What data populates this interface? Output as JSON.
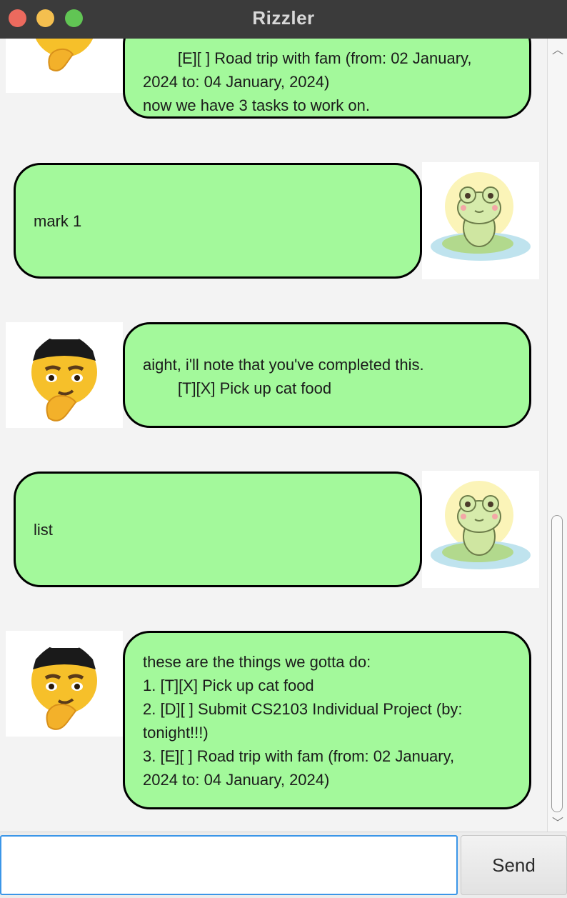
{
  "window": {
    "title": "Rizzler"
  },
  "messages": [
    {
      "sender": "bot",
      "avatar": "rizz-emoji-icon",
      "lines": [
        "        [E][ ] Road trip with fam (from: 02 January,",
        "2024 to: 04 January, 2024)",
        "now we have 3 tasks to work on."
      ]
    },
    {
      "sender": "user",
      "avatar": "frog-icon",
      "lines": [
        "mark 1"
      ]
    },
    {
      "sender": "bot",
      "avatar": "rizz-emoji-icon",
      "lines": [
        "aight, i'll note that you've completed this.",
        "        [T][X] Pick up cat food"
      ]
    },
    {
      "sender": "user",
      "avatar": "frog-icon",
      "lines": [
        "list"
      ]
    },
    {
      "sender": "bot",
      "avatar": "rizz-emoji-icon",
      "lines": [
        "these are the things we gotta do:",
        "1. [T][X] Pick up cat food",
        "2. [D][ ] Submit CS2103 Individual Project (by:",
        "tonight!!!)",
        "3. [E][ ] Road trip with fam (from: 02 January,",
        "2024 to: 04 January, 2024)"
      ]
    }
  ],
  "input": {
    "value": "",
    "placeholder": ""
  },
  "send_button": {
    "label": "Send"
  },
  "colors": {
    "bubble": "#a3f99b",
    "titlebar": "#3b3b3b",
    "focus_border": "#3b96e8"
  }
}
